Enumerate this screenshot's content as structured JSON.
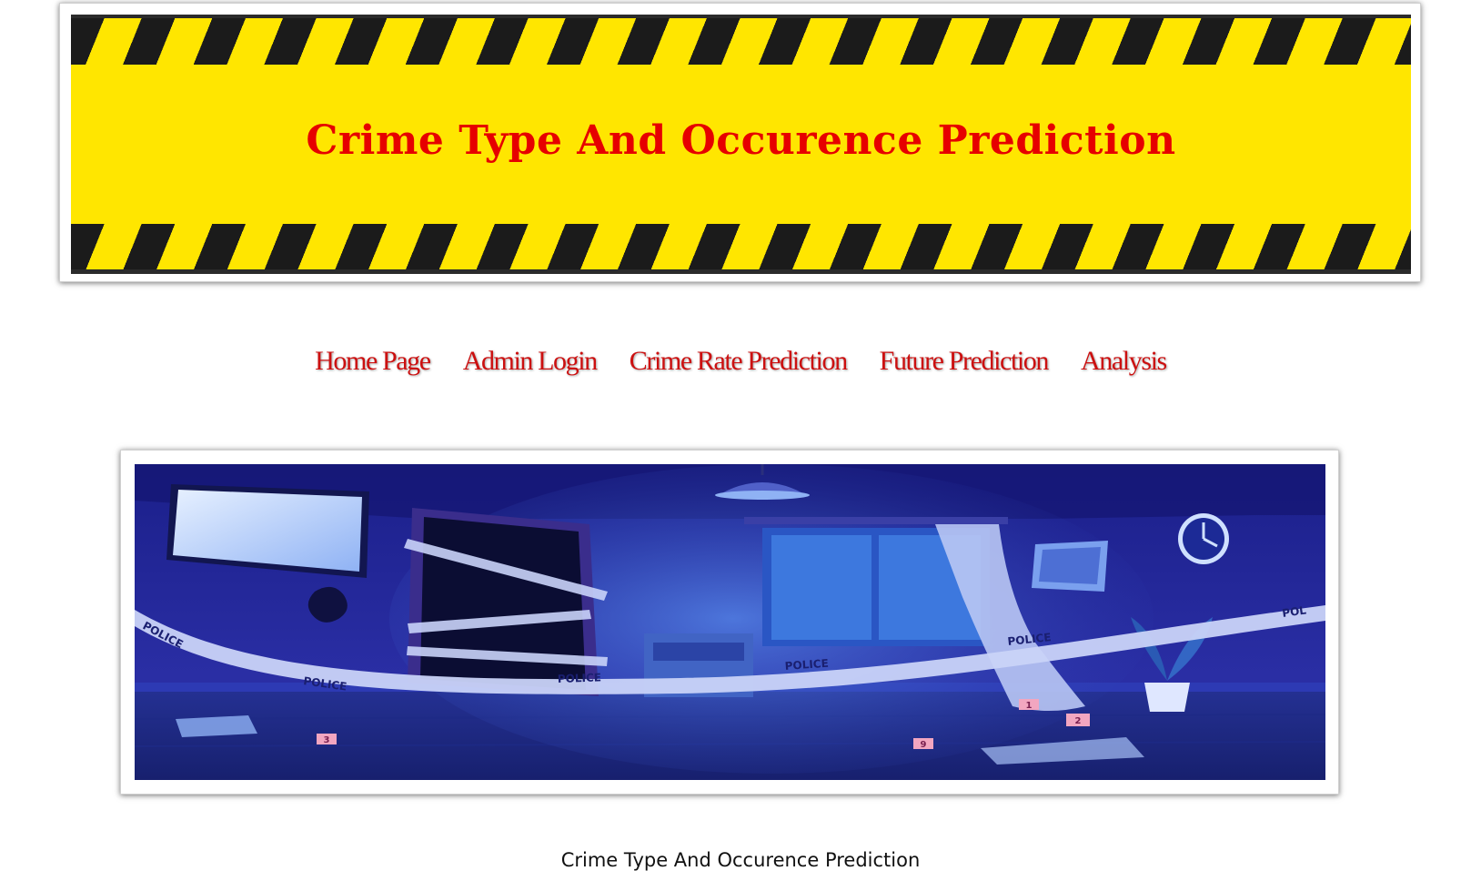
{
  "header": {
    "title": "Crime Type And Occurence Prediction",
    "colors": {
      "tape_yellow": "#ffe600",
      "tape_black": "#1b1b1b",
      "title_red": "#e60000"
    }
  },
  "nav": {
    "items": [
      {
        "label": "Home Page"
      },
      {
        "label": "Admin Login"
      },
      {
        "label": "Crime Rate Prediction"
      },
      {
        "label": "Future Prediction"
      },
      {
        "label": "Analysis"
      }
    ],
    "color": "#cc1010"
  },
  "hero": {
    "tape_labels": [
      "POLICE",
      "POLICE",
      "POLICE",
      "POLICE",
      "POLICE",
      "POL"
    ],
    "evidence_markers": [
      "1",
      "2",
      "3",
      "9"
    ]
  },
  "footer": {
    "caption": "Crime Type And Occurence Prediction"
  }
}
